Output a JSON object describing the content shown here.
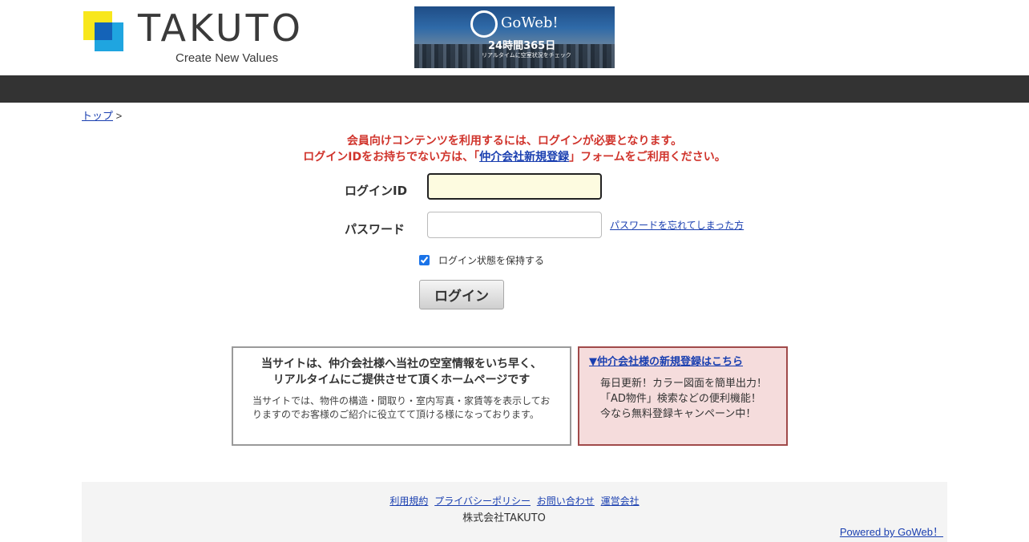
{
  "header": {
    "brand": "TAKUTO",
    "tagline": "Create New Values",
    "banner": {
      "brand": "GoWeb!",
      "hours": "24時間365日",
      "sub": "リアルタイムに空室状況をチェック"
    }
  },
  "breadcrumb": {
    "home": "トップ",
    "separator": ">"
  },
  "notice": {
    "line1": "会員向けコンテンツを利用するには、ログインが必要となります。",
    "line2_before": "ログインIDをお持ちでない方は、「",
    "line2_link": "仲介会社新規登録",
    "line2_after": "」フォームをご利用ください。"
  },
  "form": {
    "login_id_label": "ログインID",
    "login_id_value": "",
    "password_label": "パスワード",
    "password_value": "",
    "forgot_link": "パスワードを忘れてしまった方",
    "keep_login_label": "ログイン状態を保持する",
    "keep_login_checked": true,
    "login_button": "ログイン"
  },
  "info_box": {
    "heading_line1": "当サイトは、仲介会社様へ当社の空室情報をいち早く、",
    "heading_line2": "リアルタイムにご提供させて頂くホームページです",
    "body": "当サイトでは、物件の構造・間取り・室内写真・家賃等を表示しておりますのでお客様のご紹介に役立てて頂ける様になっております。"
  },
  "register_box": {
    "link": "▼仲介会社様の新規登録はこちら",
    "line1": "毎日更新！カラー図面を簡単出力！",
    "line2": "「AD物件」検索などの便利機能！",
    "line3": "今なら無料登録キャンペーン中！"
  },
  "footer": {
    "links": [
      "利用規約",
      "プライバシーポリシー",
      "お問い合わせ",
      "運営会社"
    ],
    "company": "株式会社TAKUTO",
    "powered": "Powered by GoWeb！"
  },
  "colors": {
    "navbar": "#333333",
    "notice_red": "#d0342c",
    "link_blue": "#1a3fb0",
    "register_bg": "#f5dcdc",
    "register_border": "#a04a4a"
  }
}
